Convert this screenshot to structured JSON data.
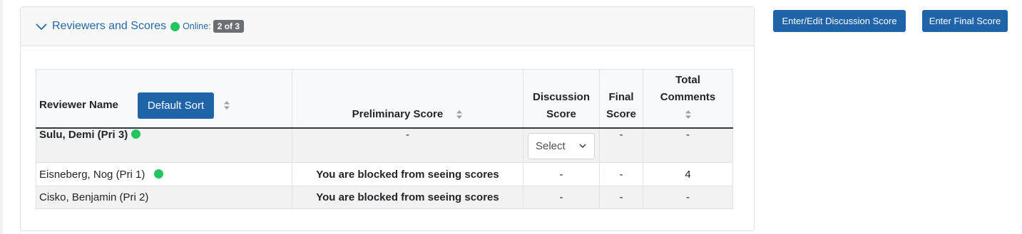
{
  "panel": {
    "title": "Reviewers and Scores",
    "online_label": "Online:",
    "online_badge": "2 of 3"
  },
  "actions": {
    "discussion_button": "Enter/Edit Discussion Score",
    "final_button": "Enter Final Score"
  },
  "table": {
    "headers": {
      "reviewer_name": "Reviewer Name",
      "default_sort": "Default Sort",
      "preliminary": "Preliminary Score",
      "discussion_line1": "Discussion",
      "discussion_line2": "Score",
      "final_line1": "Final",
      "final_line2": "Score",
      "total_line1": "Total",
      "total_line2": "Comments"
    },
    "rows": [
      {
        "name": "Sulu, Demi (Pri 3)",
        "online": true,
        "preliminary": "-",
        "discussion_select": "Select",
        "final": "-",
        "total": "-"
      },
      {
        "name": "Eisneberg, Nog (Pri 1)",
        "online": true,
        "preliminary": "You are blocked from seeing scores",
        "discussion": "-",
        "final": "-",
        "total": "4"
      },
      {
        "name": "Cisko, Benjamin (Pri 2)",
        "online": false,
        "preliminary": "You are blocked from seeing scores",
        "discussion": "-",
        "final": "-",
        "total": "-"
      }
    ]
  },
  "colors": {
    "accent": "#1f63a8",
    "link": "#2469a6",
    "online": "#22c55e",
    "badge": "#6b6f73"
  }
}
